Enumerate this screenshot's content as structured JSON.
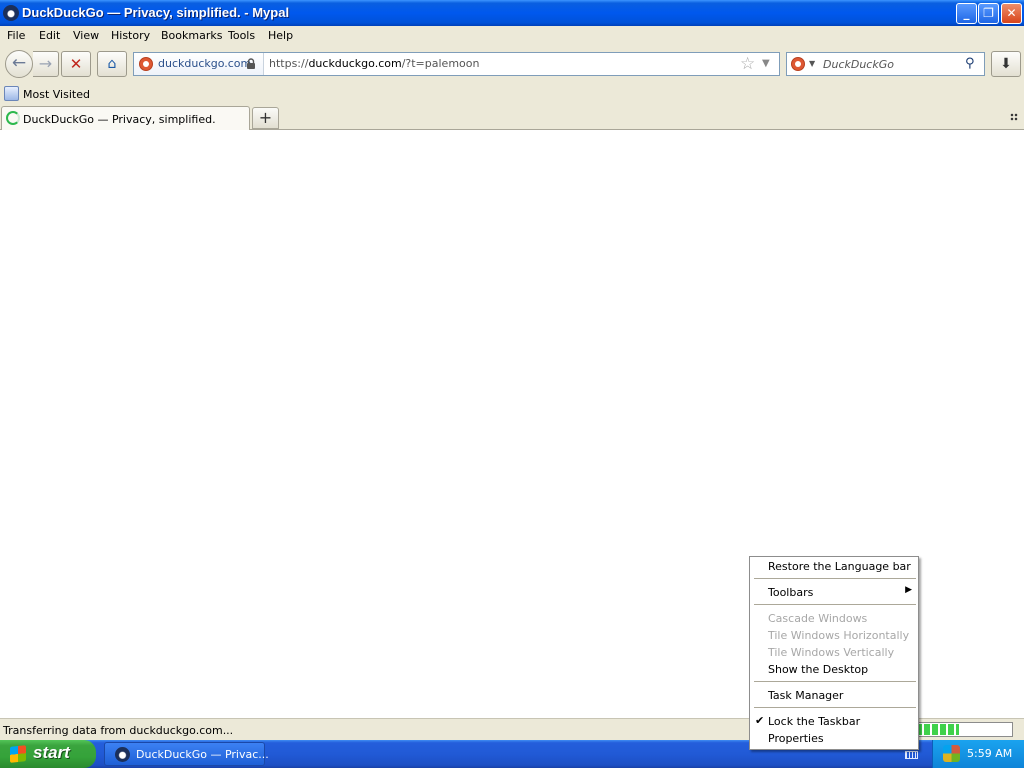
{
  "window": {
    "title": "DuckDuckGo — Privacy, simplified. - Mypal",
    "minimize_label": "_",
    "restore_label": "❐",
    "close_label": "✕"
  },
  "menubar": {
    "items": [
      "File",
      "Edit",
      "View",
      "History",
      "Bookmarks",
      "Tools",
      "Help"
    ]
  },
  "navbar": {
    "back_icon": "←",
    "forward_icon": "→",
    "stop_icon": "✕",
    "home_icon": "⌂",
    "identity_domain": "duckduckgo.com",
    "url_scheme": "https://",
    "url_host": "duckduckgo.com",
    "url_path": "/?t=palemoon",
    "star_icon": "☆",
    "dropdown_icon": "▼",
    "search_placeholder": "DuckDuckGo",
    "search_icon": "⚲",
    "download_icon": "⬇"
  },
  "bookmarks": {
    "items": [
      "Most Visited"
    ]
  },
  "tabs": {
    "items": [
      {
        "label": "DuckDuckGo — Privacy, simplified.",
        "loading": true
      }
    ],
    "new_tab_label": "+"
  },
  "statusbar": {
    "text": "Transferring data from duckduckgo.com...",
    "progress": 0.45
  },
  "taskbar": {
    "start_label": "start",
    "task_label": "DuckDuckGo — Privac...",
    "clock": "5:59 AM"
  },
  "context_menu": {
    "restore_language_bar": "Restore the Language bar",
    "toolbars": "Toolbars",
    "cascade_windows": "Cascade Windows",
    "tile_horizontally": "Tile Windows Horizontally",
    "tile_vertically": "Tile Windows Vertically",
    "show_desktop": "Show the Desktop",
    "task_manager": "Task Manager",
    "lock_taskbar": "Lock the Taskbar",
    "properties": "Properties",
    "submenu_arrow": "▶",
    "check_mark": "✔"
  },
  "colors": {
    "titlebar": "#0058ee",
    "chrome": "#ece9d8",
    "start_green": "#35a33a",
    "taskbar_blue": "#245edb",
    "progress_green": "#3fd14a",
    "ddg_orange": "#de5833"
  },
  "icons": {
    "app": "raccoon-icon",
    "identity": "ddg-logo-icon",
    "lock": "lock-icon",
    "most_visited": "bookmark-folder-icon",
    "tab_spinner": "loading-spinner-icon",
    "tab_grid": "tab-grid-icon",
    "start": "windows-flag-icon",
    "keyboard": "keyboard-icon",
    "tray": "tray-network-icon"
  }
}
